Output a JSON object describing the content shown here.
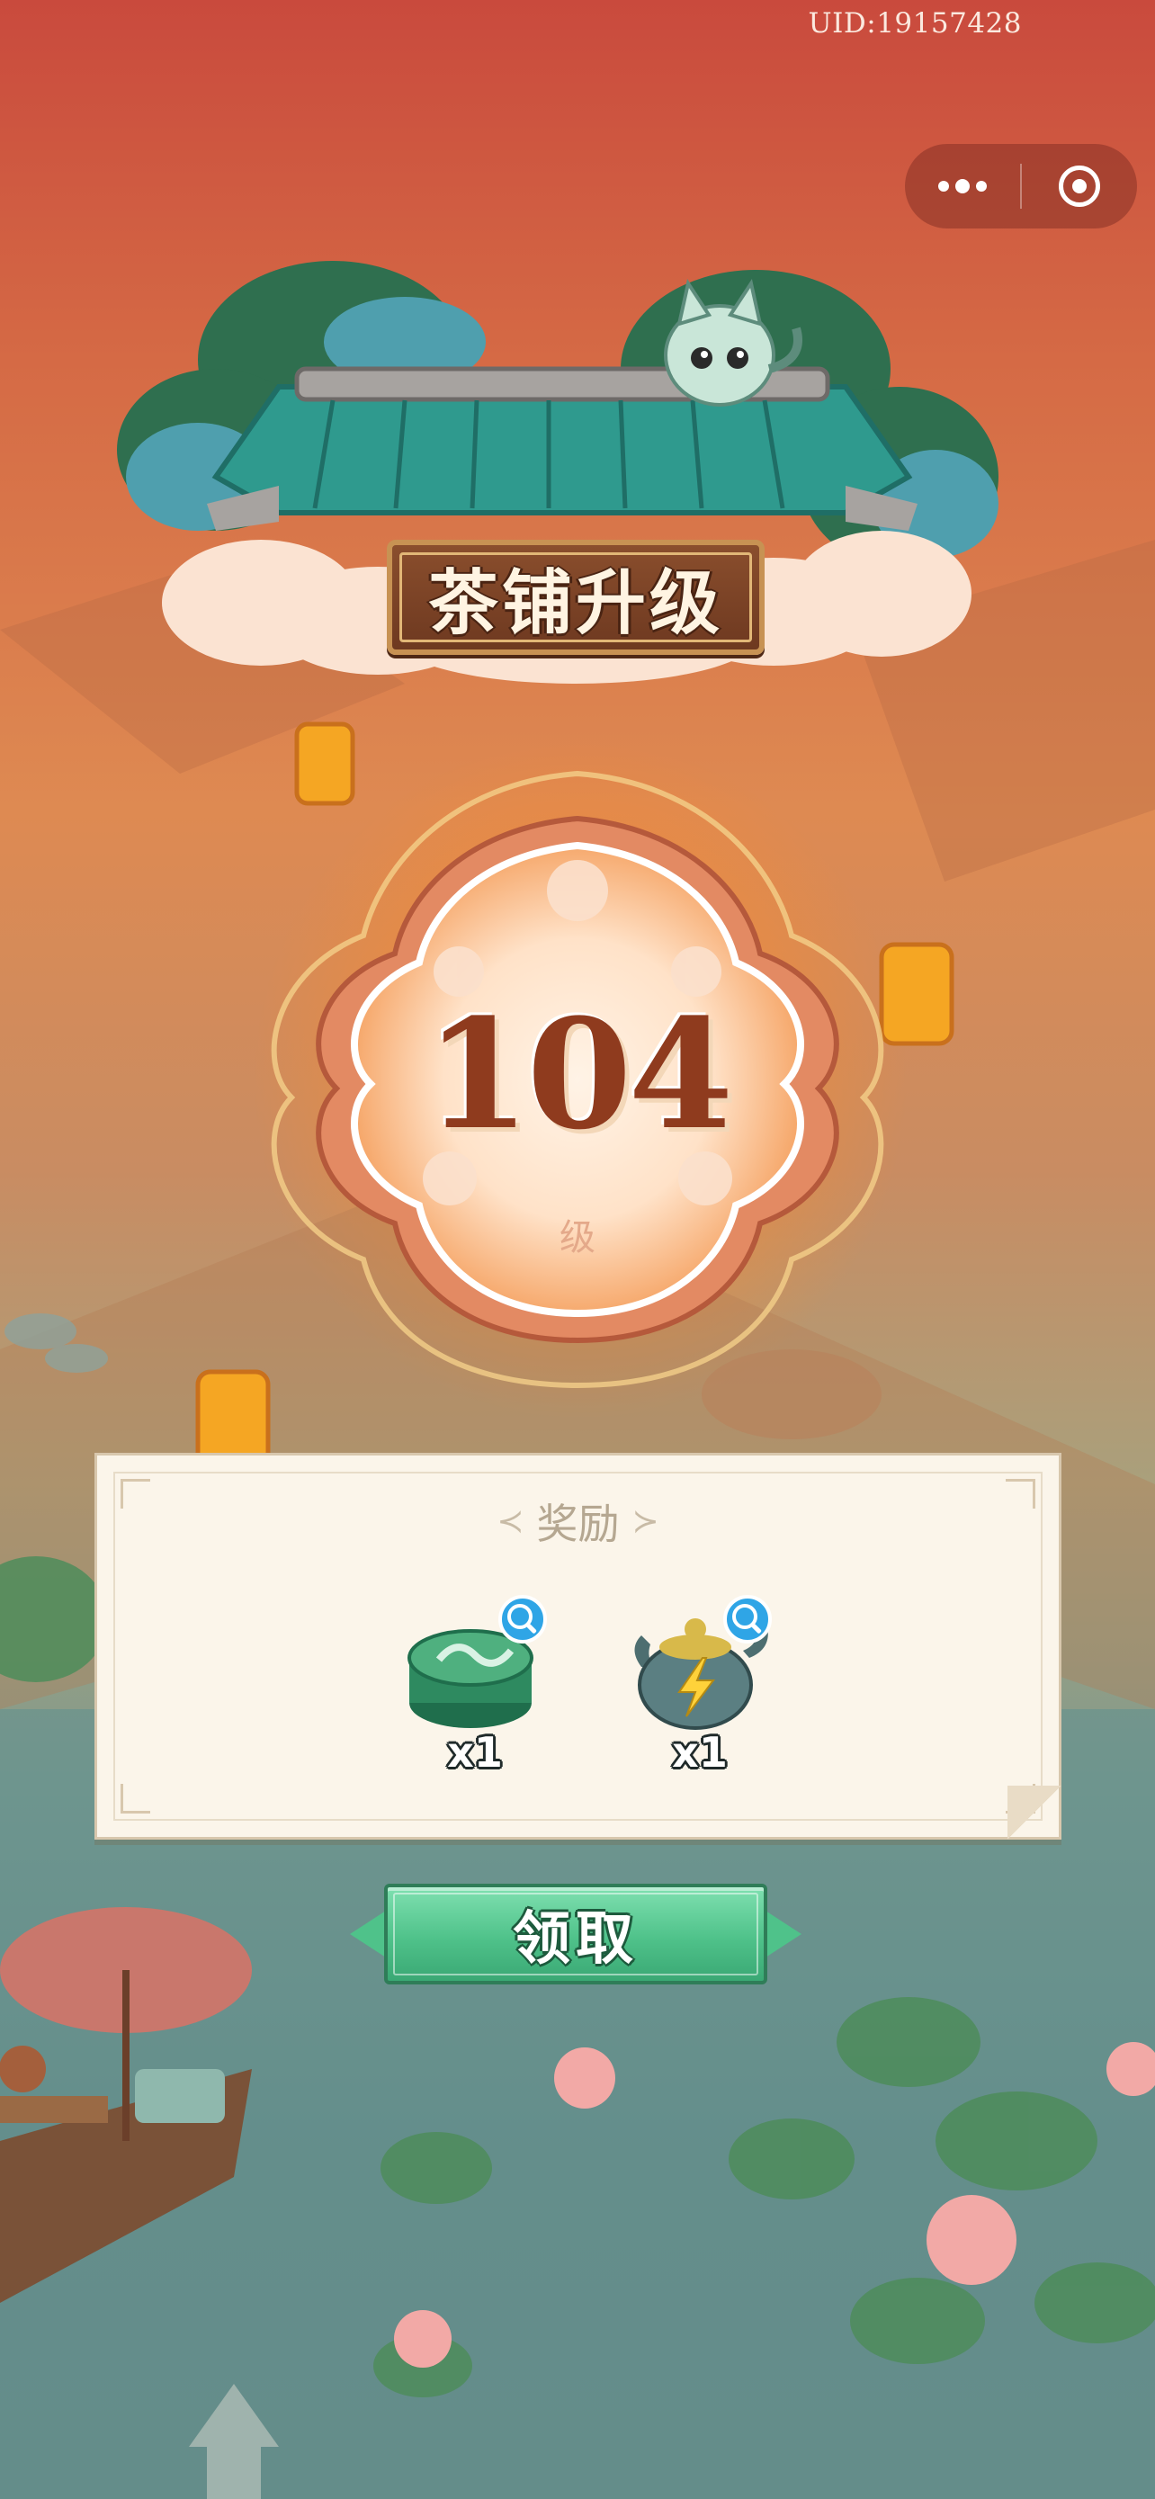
{
  "header": {
    "uid": "UID:19157428",
    "capsule": {
      "more_icon": "more-dots-icon",
      "close_icon": "target-close-icon"
    }
  },
  "title": {
    "text": "茶铺升级"
  },
  "level": {
    "value": "104",
    "unit": "级"
  },
  "rewards": {
    "title": "奖励",
    "items": [
      {
        "name": "green-tea-tin",
        "icon": "tea-tin-icon",
        "quantity": "x1"
      },
      {
        "name": "energy-teapot",
        "icon": "lightning-teapot-icon",
        "quantity": "x1"
      }
    ]
  },
  "claim_button": {
    "label": "领取"
  },
  "colors": {
    "sky_top": "#c94a3d",
    "glow": "#ff8c28",
    "level_text": "#8f3b1e",
    "button_green": "#4fc28a",
    "magnify_blue": "#2fa5e6",
    "roof_teal": "#2f9a8e",
    "plaque_brown": "#7a4025"
  }
}
